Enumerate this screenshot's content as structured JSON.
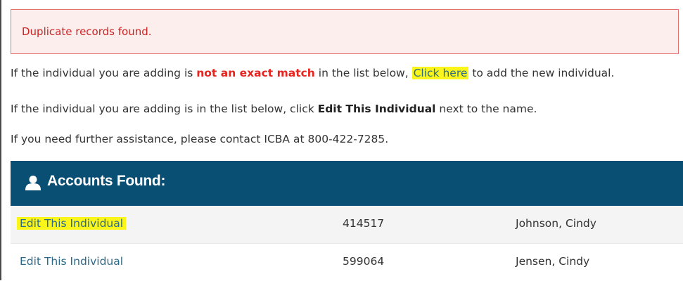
{
  "alert": {
    "message": "Duplicate records found."
  },
  "instructions": {
    "line1": {
      "prefix": "If the individual you are adding is ",
      "emphasis": "not an exact match",
      "middle": " in the list below, ",
      "link": "Click here",
      "suffix": " to add the new individual."
    },
    "line2": {
      "prefix": "If the individual you are adding is in the list below, click ",
      "bold": "Edit This Individual",
      "suffix": " next to the name."
    },
    "line3": "If you need further assistance, please contact ICBA at 800-422-7285."
  },
  "panel": {
    "title": "Accounts Found:",
    "icon": "user-icon",
    "header_color": "#094f73"
  },
  "accounts": [
    {
      "action": "Edit This Individual",
      "id": "414517",
      "name": "Johnson, Cindy"
    },
    {
      "action": "Edit This Individual",
      "id": "599064",
      "name": "Jensen, Cindy"
    }
  ],
  "colors": {
    "highlight": "#fbf51a",
    "emphasis": "#e8241f",
    "link": "#2b6a8c",
    "alert_text": "#cc2222",
    "alert_border": "#e2716f"
  }
}
